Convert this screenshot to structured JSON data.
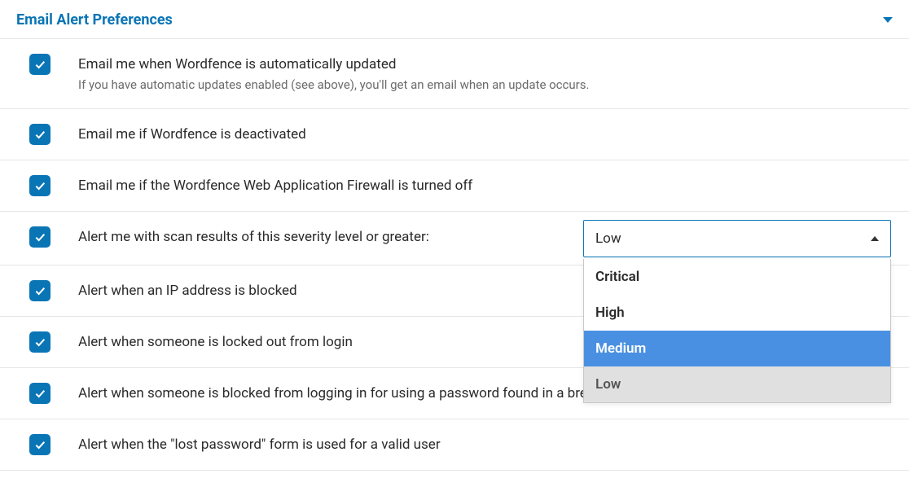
{
  "header": {
    "title": "Email Alert Preferences"
  },
  "rows": [
    {
      "label": "Email me when Wordfence is automatically updated",
      "sublabel": "If you have automatic updates enabled (see above), you'll get an email when an update occurs."
    },
    {
      "label": "Email me if Wordfence is deactivated"
    },
    {
      "label": "Email me if the Wordfence Web Application Firewall is turned off"
    },
    {
      "label": "Alert me with scan results of this severity level or greater:"
    },
    {
      "label": "Alert when an IP address is blocked"
    },
    {
      "label": "Alert when someone is locked out from login"
    },
    {
      "label": "Alert when someone is blocked from logging in for using a password found in a breach"
    },
    {
      "label": "Alert when the \"lost password\" form is used for a valid user"
    }
  ],
  "severity_select": {
    "value": "Low",
    "options": [
      "Critical",
      "High",
      "Medium",
      "Low"
    ],
    "highlighted": "Medium",
    "selected": "Low"
  }
}
